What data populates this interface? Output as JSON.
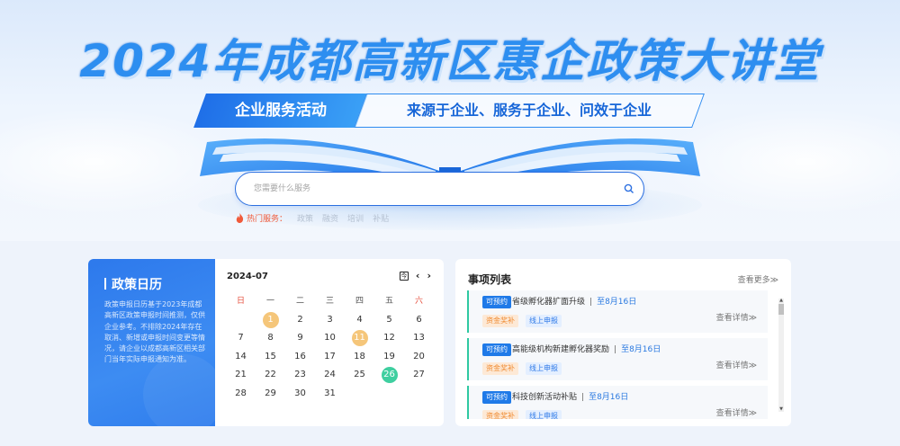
{
  "hero": {
    "title": "2024年成都高新区惠企政策大讲堂",
    "banner_left": "企业服务活动",
    "banner_right": "来源于企业、服务于企业、问效于企业",
    "search_placeholder": "您需要什么服务",
    "hot_label": "热门服务：",
    "hot_tags": [
      "政策",
      "融资",
      "培训",
      "补贴"
    ]
  },
  "calendar": {
    "panel_title": "政策日历",
    "panel_desc": "政策申报日历基于2023年成都高新区政策申报时间推测，仅供企业参考。不排除2024年存在取消、新增或申报时间变更等情况，请企业以成都高新区相关部门当年实际申报通知为准。",
    "month": "2024-07",
    "today_icon": "today-icon",
    "weekdays": [
      "日",
      "一",
      "二",
      "三",
      "四",
      "五",
      "六"
    ],
    "weeks": [
      [
        "",
        "1",
        "2",
        "3",
        "4",
        "5",
        "6"
      ],
      [
        "7",
        "8",
        "9",
        "10",
        "11",
        "12",
        "13"
      ],
      [
        "14",
        "15",
        "16",
        "17",
        "18",
        "19",
        "20"
      ],
      [
        "21",
        "22",
        "23",
        "24",
        "25",
        "26",
        "27"
      ],
      [
        "28",
        "29",
        "30",
        "31",
        "",
        "",
        ""
      ]
    ],
    "highlight_orange": [
      "1",
      "11"
    ],
    "highlight_green": [
      "26"
    ],
    "colors": {
      "orange": "#f5c67a",
      "green": "#3fcfa0",
      "weekend": "#e64e3c"
    }
  },
  "tasks": {
    "title": "事项列表",
    "more": "查看更多≫",
    "items": [
      {
        "badge": "可预约",
        "name": "省级孵化器扩面升级",
        "deadline": "至8月16日",
        "tag1": "资金奖补",
        "tag2": "线上申报",
        "view": "查看详情≫"
      },
      {
        "badge": "可预约",
        "name": "高能级机构新建孵化器奖励",
        "deadline": "至8月16日",
        "tag1": "资金奖补",
        "tag2": "线上申报",
        "view": "查看详情≫"
      },
      {
        "badge": "可预约",
        "name": "科技创新活动补贴",
        "deadline": "至8月16日",
        "tag1": "资金奖补",
        "tag2": "线上申报",
        "view": "查看详情≫"
      }
    ]
  }
}
